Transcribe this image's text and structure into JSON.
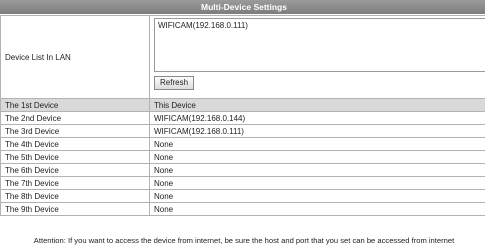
{
  "title": "Multi-Device Settings",
  "lan": {
    "label": "Device List In LAN",
    "devices": [
      "WIFICAM(192.168.0.111)"
    ],
    "refresh_label": "Refresh"
  },
  "devices": [
    {
      "label": "The 1st Device",
      "value": "This Device"
    },
    {
      "label": "The 2nd Device",
      "value": "WIFICAM(192.168.0.144)"
    },
    {
      "label": "The 3rd Device",
      "value": "WIFICAM(192.168.0.111)"
    },
    {
      "label": "The 4th Device",
      "value": "None"
    },
    {
      "label": "The 5th Device",
      "value": "None"
    },
    {
      "label": "The 6th Device",
      "value": "None"
    },
    {
      "label": "The 7th Device",
      "value": "None"
    },
    {
      "label": "The 8th Device",
      "value": "None"
    },
    {
      "label": "The 9th Device",
      "value": "None"
    }
  ],
  "attention": "Attention: If you want to access the device from internet, be sure the host and port that you set can be accessed from internet",
  "colors": {
    "title_bar": "#8a8a8a",
    "header_row": "#d9d9d9",
    "border": "#b3b3b3"
  }
}
